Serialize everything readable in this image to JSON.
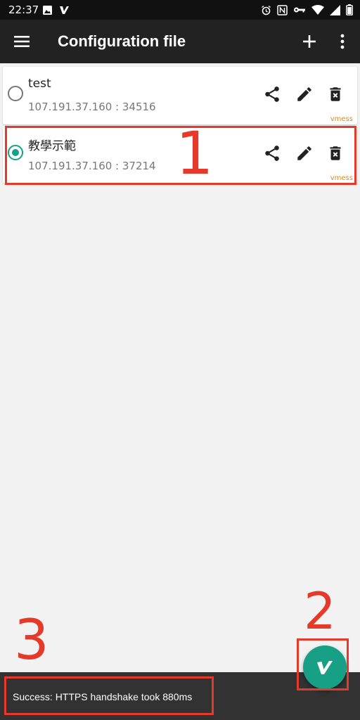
{
  "status_bar": {
    "time": "22:37",
    "icons_left": [
      "image-icon",
      "v-app-icon"
    ],
    "icons_right": [
      "alarm-icon",
      "nfc-icon",
      "vpn-key-icon",
      "wifi-icon",
      "signal-icon",
      "battery-icon"
    ]
  },
  "app_bar": {
    "title": "Configuration file",
    "icons": [
      "menu-icon",
      "plus-icon",
      "more-vert-icon"
    ]
  },
  "configs": [
    {
      "name": "test",
      "address": "107.191.37.160 : 34516",
      "type": "vmess",
      "selected": false
    },
    {
      "name": "教學示範",
      "address": "107.191.37.160 : 37214",
      "type": "vmess",
      "selected": true
    }
  ],
  "annotations": {
    "n1": "1",
    "n2": "2",
    "n3": "3"
  },
  "snackbar": {
    "message": "Success: HTTPS handshake took 880ms"
  },
  "colors": {
    "accent": "#17a085",
    "annotation": "#e53a2a",
    "type_label": "#d98c1a",
    "app_bar": "#222222"
  }
}
